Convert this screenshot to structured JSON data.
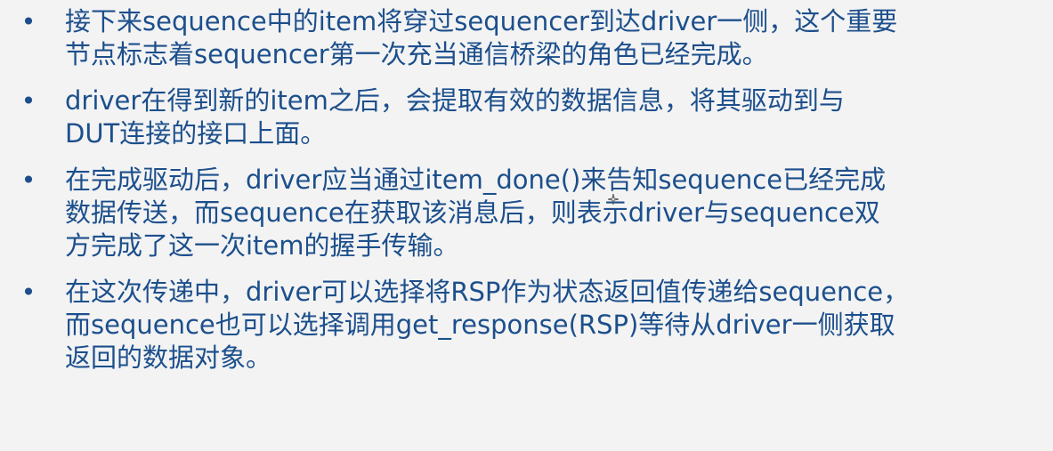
{
  "bullets": [
    {
      "marker": "•",
      "lines": [
        "接下来sequence中的item将穿过sequencer到达driver一侧，这个重要",
        "节点标志着sequencer第一次充当通信桥梁的角色已经完成。"
      ]
    },
    {
      "marker": "•",
      "lines": [
        "driver在得到新的item之后，会提取有效的数据信息，将其驱动到与",
        "DUT连接的接口上面。"
      ]
    },
    {
      "marker": "•",
      "lines": [
        "在完成驱动后，driver应当通过item_done()来告知sequence已经完成",
        "数据传送，而sequence在获取该消息后，则表示driver与sequence双",
        "方完成了这一次item的握手传输。"
      ]
    },
    {
      "marker": "•",
      "lines": [
        "在这次传递中，driver可以选择将RSP作为状态返回值传递给sequence，",
        "而sequence也可以选择调用get_response(RSP)等待从driver一侧获取",
        "返回的数据对象。"
      ]
    }
  ],
  "cursor_icon": "mouse-cursor-icon"
}
